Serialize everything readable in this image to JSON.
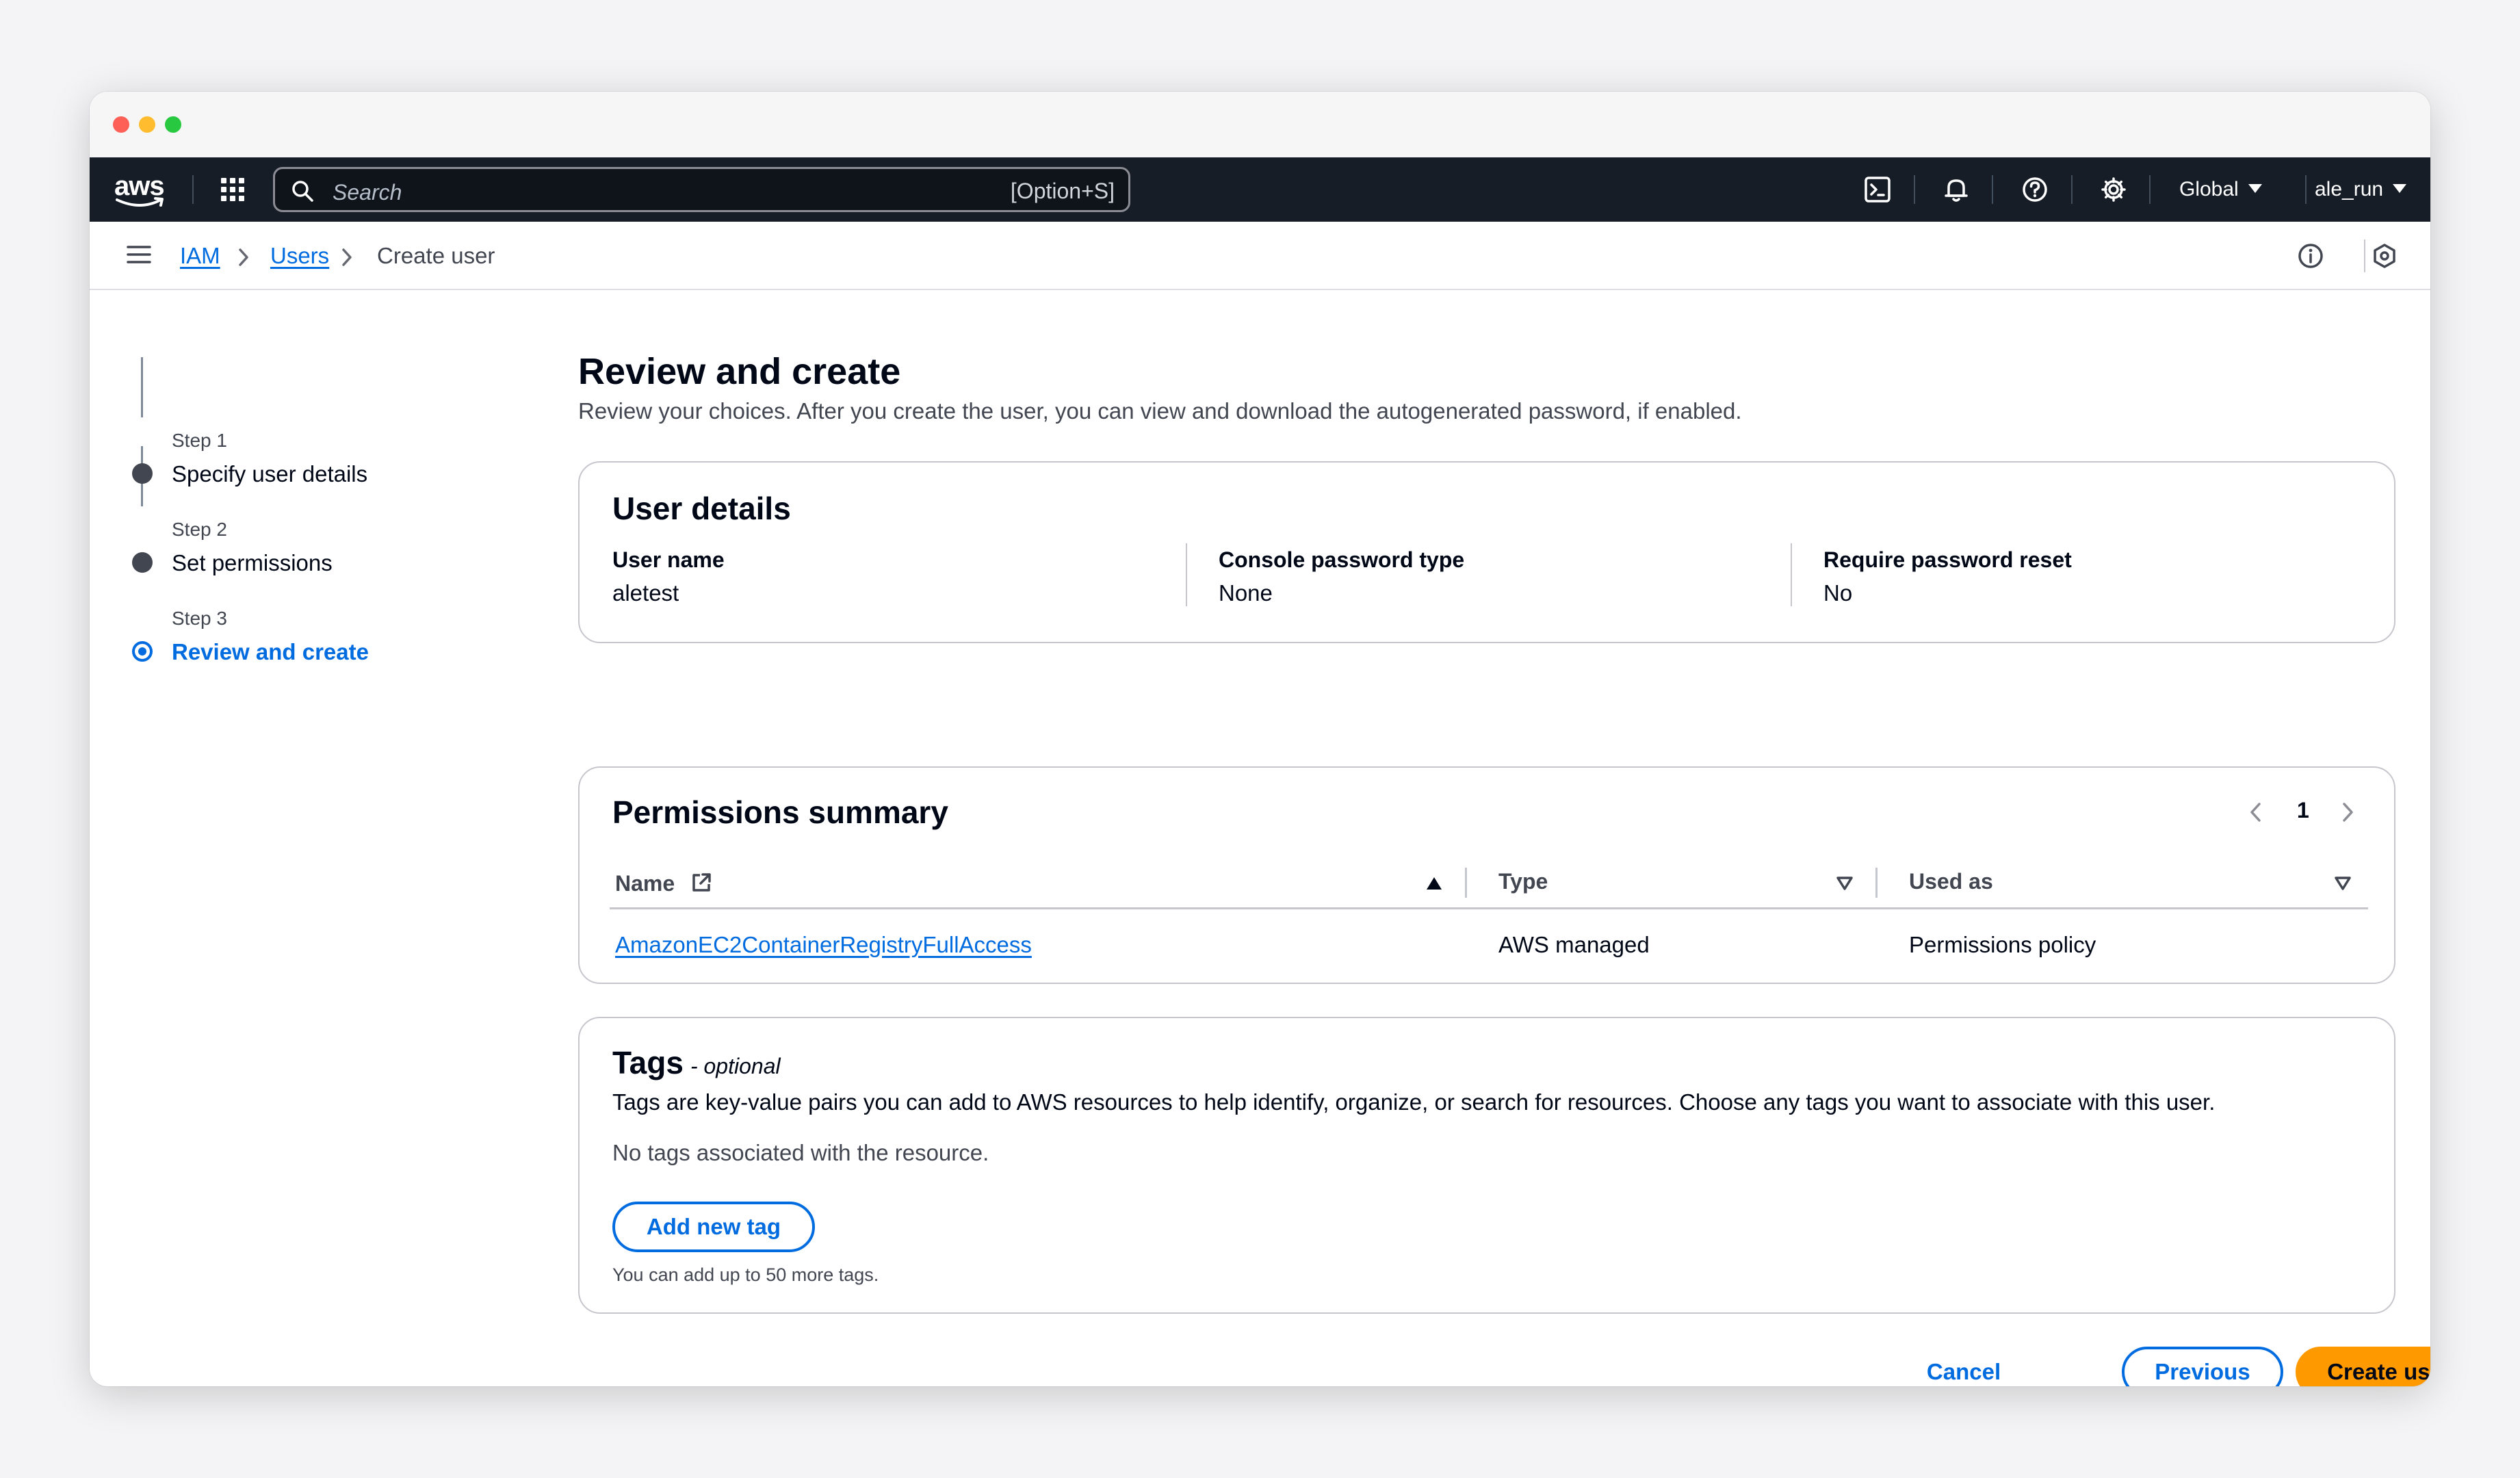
{
  "topnav": {
    "logo_text": "aws",
    "search_placeholder": "Search",
    "search_shortcut": "[Option+S]",
    "region": "Global",
    "account": "ale_run"
  },
  "breadcrumb": {
    "items": [
      {
        "label": "IAM"
      },
      {
        "label": "Users"
      },
      {
        "label": "Create user"
      }
    ]
  },
  "steps": [
    {
      "number": "Step 1",
      "title": "Specify user details"
    },
    {
      "number": "Step 2",
      "title": "Set permissions"
    },
    {
      "number": "Step 3",
      "title": "Review and create"
    }
  ],
  "page": {
    "title": "Review and create",
    "description": "Review your choices. After you create the user, you can view and download the autogenerated password, if enabled."
  },
  "user_details": {
    "title": "User details",
    "fields": [
      {
        "label": "User name",
        "value": "aletest"
      },
      {
        "label": "Console password type",
        "value": "None"
      },
      {
        "label": "Require password reset",
        "value": "No"
      }
    ]
  },
  "permissions": {
    "title": "Permissions summary",
    "page": "1",
    "columns": [
      "Name",
      "Type",
      "Used as"
    ],
    "rows": [
      {
        "name": "AmazonEC2ContainerRegistryFullAccess",
        "type": "AWS managed",
        "used_as": "Permissions policy"
      }
    ]
  },
  "tags": {
    "title": "Tags",
    "optional": "- optional",
    "description": "Tags are key-value pairs you can add to AWS resources to help identify, organize, or search for resources. Choose any tags you want to associate with this user.",
    "empty": "No tags associated with the resource.",
    "add_button": "Add new tag",
    "hint": "You can add up to 50 more tags."
  },
  "actions": {
    "cancel": "Cancel",
    "previous": "Previous",
    "create": "Create user"
  },
  "colors": {
    "nav_bg": "#161d26",
    "link": "#006ce0",
    "primary_button": "#ff9900",
    "border": "#c6c6cd"
  }
}
